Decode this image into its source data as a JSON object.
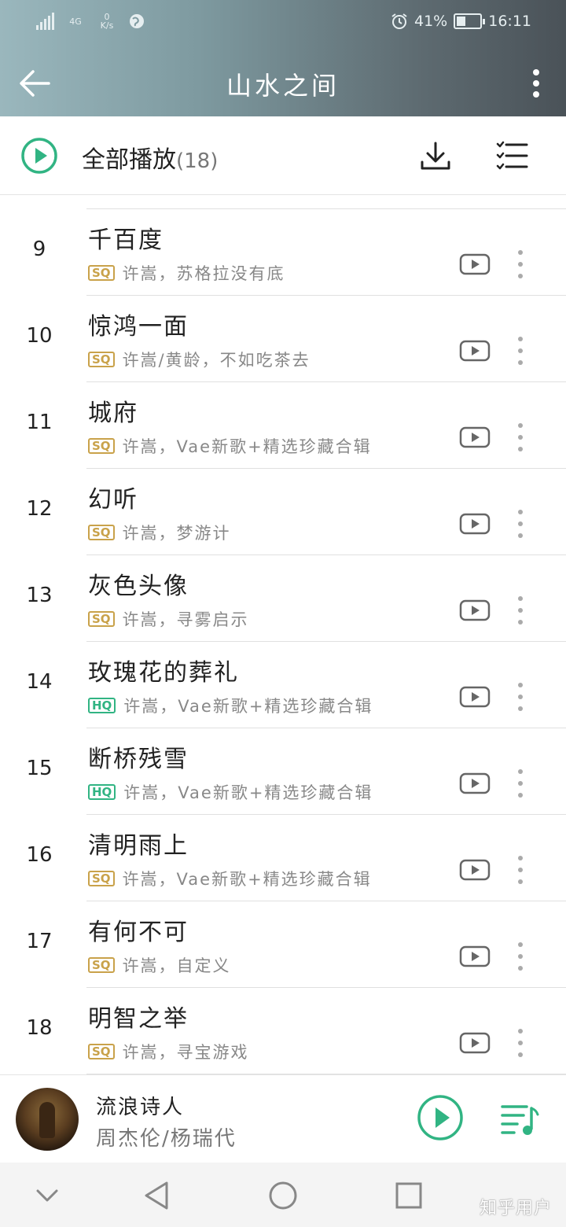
{
  "status_bar": {
    "network_type": "4G",
    "speed_value": "0",
    "speed_unit": "K/s",
    "battery_percent": "41%",
    "battery_level": 0.41,
    "time": "16:11"
  },
  "header": {
    "title": "山水之间"
  },
  "play_all": {
    "label": "全部播放",
    "count": "(18)"
  },
  "songs": [
    {
      "num": "9",
      "name": "千百度",
      "quality": "SQ",
      "artist_album": "许嵩，苏格拉没有底"
    },
    {
      "num": "10",
      "name": "惊鸿一面",
      "quality": "SQ",
      "artist_album": "许嵩/黄龄，不如吃茶去"
    },
    {
      "num": "11",
      "name": "城府",
      "quality": "SQ",
      "artist_album": "许嵩，Vae新歌+精选珍藏合辑"
    },
    {
      "num": "12",
      "name": "幻听",
      "quality": "SQ",
      "artist_album": "许嵩，梦游计"
    },
    {
      "num": "13",
      "name": "灰色头像",
      "quality": "SQ",
      "artist_album": "许嵩，寻雾启示"
    },
    {
      "num": "14",
      "name": "玫瑰花的葬礼",
      "quality": "HQ",
      "artist_album": "许嵩，Vae新歌+精选珍藏合辑"
    },
    {
      "num": "15",
      "name": "断桥残雪",
      "quality": "HQ",
      "artist_album": "许嵩，Vae新歌+精选珍藏合辑"
    },
    {
      "num": "16",
      "name": "清明雨上",
      "quality": "SQ",
      "artist_album": "许嵩，Vae新歌+精选珍藏合辑"
    },
    {
      "num": "17",
      "name": "有何不可",
      "quality": "SQ",
      "artist_album": "许嵩，自定义"
    },
    {
      "num": "18",
      "name": "明智之举",
      "quality": "SQ",
      "artist_album": "许嵩，寻宝游戏"
    }
  ],
  "now_playing": {
    "title": "流浪诗人",
    "artist": "周杰伦/杨瑞代"
  },
  "watermark": "知乎用户",
  "colors": {
    "accent_green": "#31b483",
    "sq_gold": "#c9a24a",
    "hq_green": "#31b483"
  },
  "icons": {
    "back": "arrow-left-icon",
    "more": "more-vertical-icon",
    "play_all": "play-circle-icon",
    "download": "download-icon",
    "multi_select": "multi-select-list-icon",
    "mv": "mv-video-icon",
    "song_more": "more-vertical-icon",
    "queue": "playlist-queue-icon",
    "nav_collapse": "chevron-down-icon",
    "nav_back": "triangle-back-icon",
    "nav_home": "circle-home-icon",
    "nav_recents": "square-recents-icon"
  }
}
